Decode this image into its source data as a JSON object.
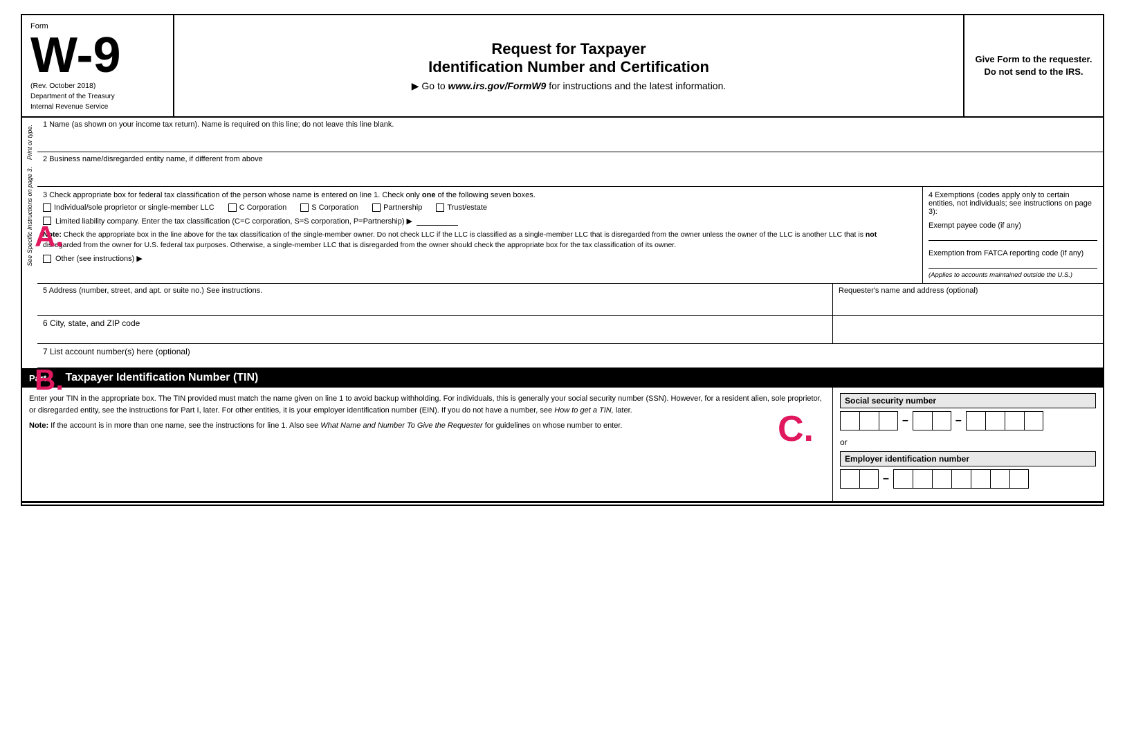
{
  "form": {
    "label": "Form",
    "name": "W-9",
    "rev": "(Rev. October 2018)",
    "dept1": "Department of the Treasury",
    "dept2": "Internal Revenue Service",
    "title_line1": "Request for Taxpayer",
    "title_line2": "Identification Number and Certification",
    "goto": "▶ Go to",
    "goto_url": "www.irs.gov/FormW9",
    "goto_suffix": "for instructions and the latest information.",
    "give_form": "Give Form to the requester. Do not send to the IRS."
  },
  "fields": {
    "row1_label": "1  Name (as shown on your income tax return). Name is required on this line; do not leave this line blank.",
    "row2_label": "2  Business name/disregarded entity name, if different from above",
    "row3_label": "3  Check appropriate box for federal tax classification of the person whose name is entered on line 1. Check only",
    "row3_bold": "one",
    "row3_suffix": "of the following seven boxes.",
    "chk_individual": "Individual/sole proprietor or single-member LLC",
    "chk_c_corp": "C Corporation",
    "chk_s_corp": "S Corporation",
    "chk_partnership": "Partnership",
    "chk_trust": "Trust/estate",
    "llc_label": "Limited liability company. Enter the tax classification (C=C corporation, S=S corporation, P=Partnership) ▶",
    "note_label": "Note:",
    "note_text": "Check the appropriate box in the line above for the tax classification of the single-member owner.  Do not check LLC if the LLC is classified as a single-member LLC that is disregarded from the owner unless the owner of the LLC is another LLC that is",
    "note_bold": "not",
    "note_text2": "disregarded from the owner for U.S. federal tax purposes. Otherwise, a single-member LLC that is disregarded from the owner should check the appropriate box for the tax classification of its owner.",
    "other_label": "Other (see instructions) ▶",
    "row4_title": "4  Exemptions (codes apply only to certain entities, not individuals; see instructions on page 3):",
    "exempt_payee": "Exempt payee code (if any)",
    "fatca_label": "Exemption from FATCA reporting code (if any)",
    "fatca_note": "(Applies to accounts maintained outside the U.S.)",
    "row5_label": "5  Address (number, street, and apt. or suite no.) See instructions.",
    "requester_label": "Requester's name and address (optional)",
    "row6_label": "6  City, state, and ZIP code",
    "row7_label": "7  List account number(s) here (optional)"
  },
  "part1": {
    "label": "Part I",
    "title": "Taxpayer Identification Number (TIN)",
    "body_text1": "Enter your TIN in the appropriate box. The TIN provided must match the name given on line 1 to avoid backup withholding. For individuals, this is generally your social security number (SSN). However, for a resident alien, sole proprietor, or disregarded entity, see the instructions for Part I, later. For other entities, it is your employer identification number (EIN). If you do not have a number, see",
    "body_italics": "How to get a TIN,",
    "body_text2": "later.",
    "note_label": "Note:",
    "note_text": "If the account is in more than one name, see the instructions for line 1. Also see",
    "note_italics": "What Name and Number To Give the Requester",
    "note_text2": "for guidelines on whose number to enter.",
    "ssn_label": "Social security number",
    "or_text": "or",
    "ein_label": "Employer identification number"
  },
  "side_labels": {
    "print": "Print or type.",
    "see": "See Specific Instructions on page 3."
  },
  "annotations": {
    "a": "A.",
    "b": "B.",
    "c": "C."
  }
}
